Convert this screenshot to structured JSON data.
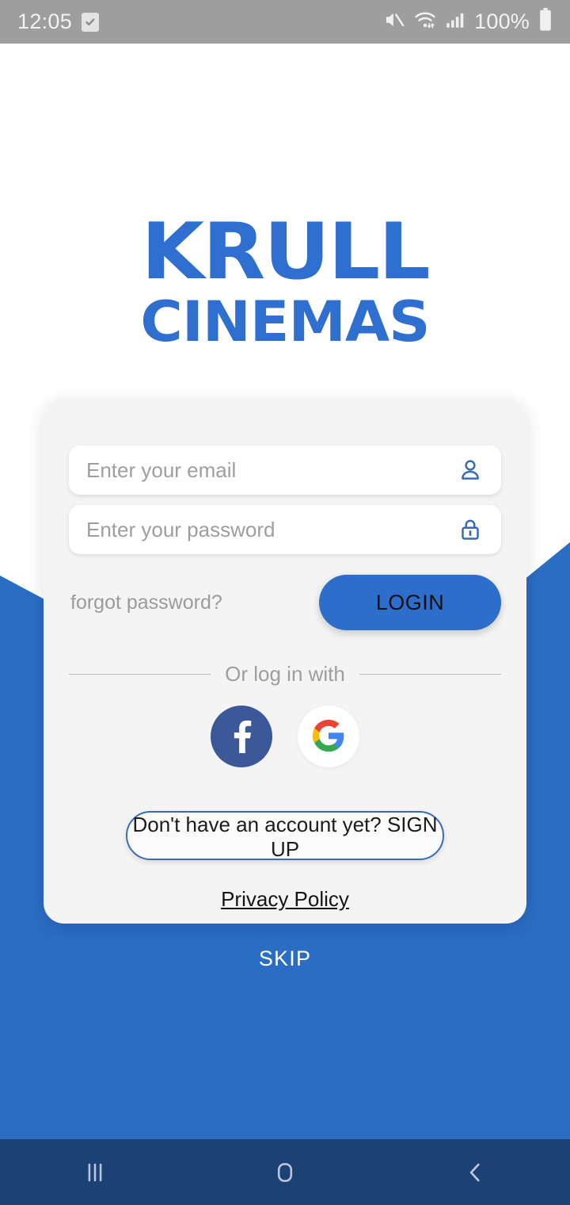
{
  "status_bar": {
    "time": "12:05",
    "battery_percent": "100%",
    "icons": [
      "task-checkbox-icon",
      "mute-icon",
      "wifi-icon",
      "signal-icon",
      "battery-icon"
    ],
    "background_color": "#9e9e9e"
  },
  "branding": {
    "logo_line1": "KRULL",
    "logo_line2": "CINEMAS",
    "logo_color": "#2f6fd0"
  },
  "form": {
    "email": {
      "placeholder": "Enter your email",
      "value": "",
      "icon": "person-icon"
    },
    "password": {
      "placeholder": "Enter your password",
      "value": "",
      "icon": "lock-icon"
    },
    "forgot_password_label": "forgot password?",
    "login_label": "LOGIN",
    "login_button_color": "#2d6ecb"
  },
  "social": {
    "divider_label": "Or log in with",
    "providers": [
      {
        "name": "facebook",
        "icon": "facebook-icon",
        "color": "#3b5998"
      },
      {
        "name": "google",
        "icon": "google-icon",
        "color": "#ffffff"
      }
    ]
  },
  "footer": {
    "signup_label": "Don't have an account yet? SIGN UP",
    "privacy_label": "Privacy Policy",
    "skip_label": "SKIP"
  },
  "theme": {
    "background_blue": "#2a6dc4",
    "card_background": "#f4f4f4",
    "nav_bar_color": "#1e4175"
  },
  "nav_bar": {
    "buttons": [
      "recents-icon",
      "home-icon",
      "back-icon"
    ]
  }
}
